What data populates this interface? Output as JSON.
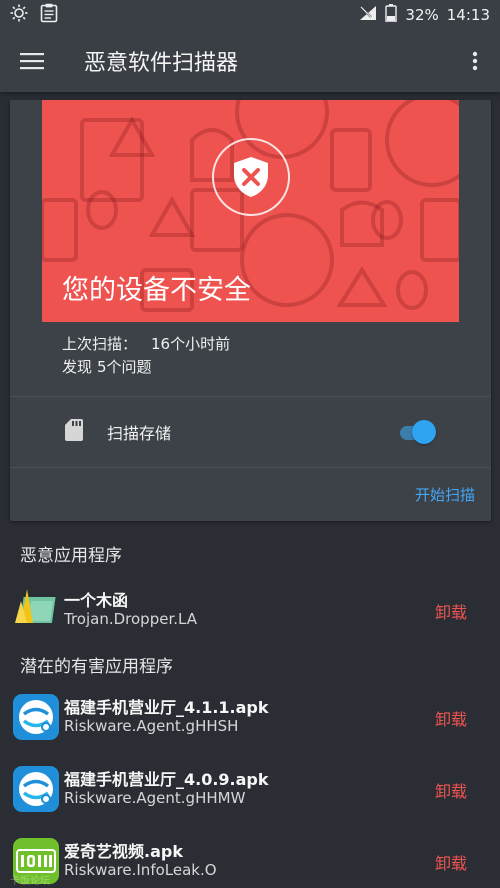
{
  "status_bar": {
    "battery_percent": "32%",
    "time": "14:13",
    "icons": [
      "settings-sun-icon",
      "clipboard-icon",
      "no-signal-icon",
      "battery-icon"
    ]
  },
  "app_bar": {
    "title": "恶意软件扫描器"
  },
  "scan_card": {
    "headline": "您的设备不安全",
    "last_scan_label": "上次扫描：",
    "last_scan_value": "16个小时前",
    "found_label": "发现",
    "found_value": "5个问题",
    "storage_label": "扫描存储",
    "storage_enabled": true,
    "start_scan": "开始扫描"
  },
  "sections": {
    "malicious_title": "恶意应用程序",
    "pua_title": "潜在的有害应用程序"
  },
  "malicious_apps": [
    {
      "name": "一个木函",
      "threat": "Trojan.Dropper.LA",
      "action": "卸载"
    }
  ],
  "pua_apps": [
    {
      "name": "福建手机营业厅_4.1.1.apk",
      "threat": "Riskware.Agent.gHHSH",
      "action": "卸载"
    },
    {
      "name": "福建手机营业厅_4.0.9.apk",
      "threat": "Riskware.Agent.gHHMW",
      "action": "卸载"
    },
    {
      "name": "爱奇艺视频.apk",
      "threat": "Riskware.InfoLeak.O",
      "action": "卸载"
    }
  ],
  "watermark": "卡饭论坛",
  "colors": {
    "accent": "#42a5f5",
    "danger": "#ef5350",
    "toolbar": "#3a3f46",
    "background": "#2a2e34"
  }
}
